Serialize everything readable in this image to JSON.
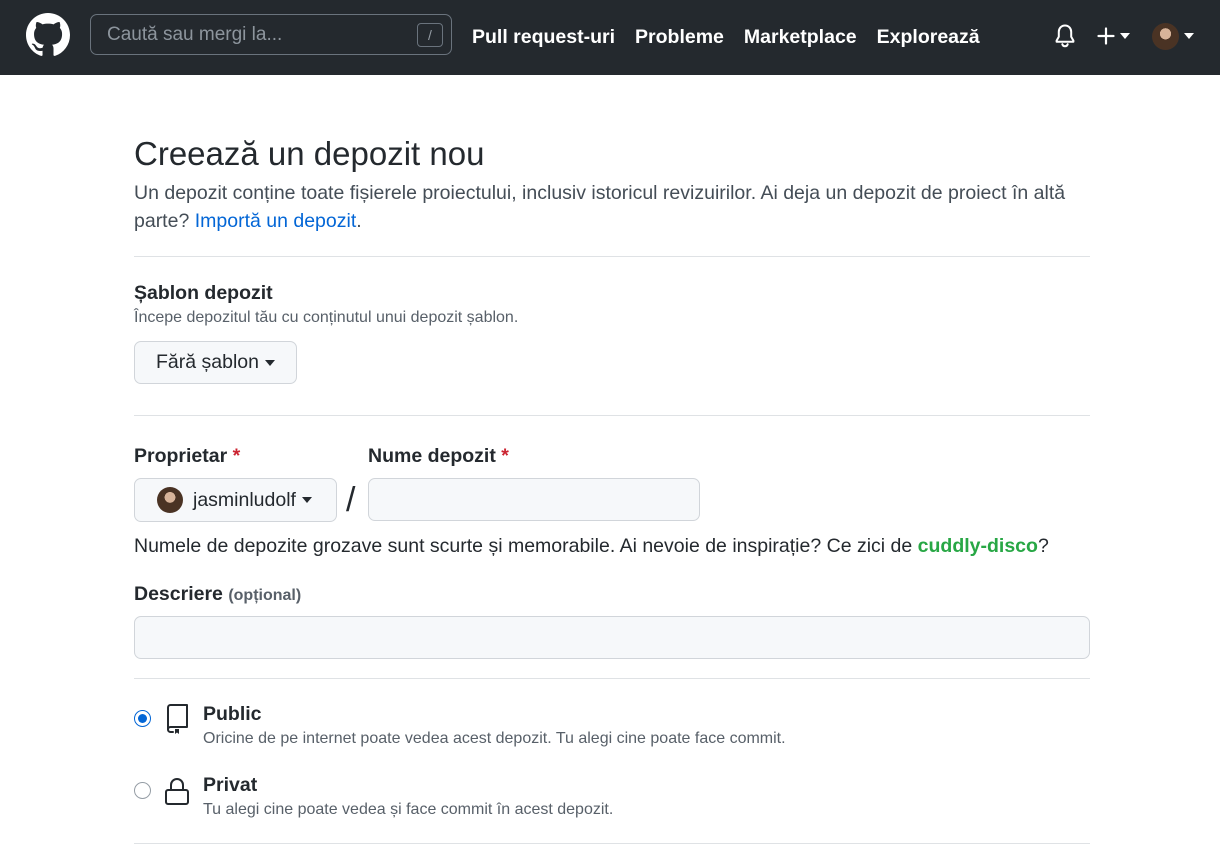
{
  "header": {
    "search_placeholder": "Caută sau mergi la...",
    "search_shortcut": "/",
    "nav": [
      "Pull request-uri",
      "Probleme",
      "Marketplace",
      "Explorează"
    ]
  },
  "page": {
    "title": "Creează un depozit nou",
    "intro_text": "Un depozit conține toate fișierele proiectului, inclusiv istoricul revizuirilor. Ai deja un depozit de proiect în altă parte?",
    "import_link": "Importă un depozit",
    "intro_end": "."
  },
  "template": {
    "label": "Șablon depozit",
    "note": "Începe depozitul tău cu conținutul unui depozit șablon.",
    "button": "Fără șablon"
  },
  "owner": {
    "label": "Proprietar",
    "required_mark": "*",
    "value": "jasminludolf"
  },
  "repo_name": {
    "label": "Nume depozit",
    "required_mark": "*",
    "value": "",
    "separator": "/"
  },
  "name_hint": {
    "text": "Numele de depozite grozave sunt scurte și memorabile. Ai nevoie de inspirație? Ce zici de",
    "suggestion": "cuddly-disco",
    "end": "?"
  },
  "description": {
    "label": "Descriere",
    "optional": "(opțional)",
    "value": ""
  },
  "visibility": {
    "selected": "public",
    "public": {
      "title": "Public",
      "desc": "Oricine de pe internet poate vedea acest depozit. Tu alegi cine poate face commit."
    },
    "private": {
      "title": "Privat",
      "desc": "Tu alegi cine poate vedea și face commit în acest depozit."
    }
  },
  "colors": {
    "header_bg": "#24292e",
    "link": "#0366d6",
    "suggestion": "#28a745",
    "required": "#cb2431"
  },
  "icons": [
    "github-logo-icon",
    "bell-icon",
    "plus-icon",
    "repo-icon",
    "lock-icon"
  ]
}
